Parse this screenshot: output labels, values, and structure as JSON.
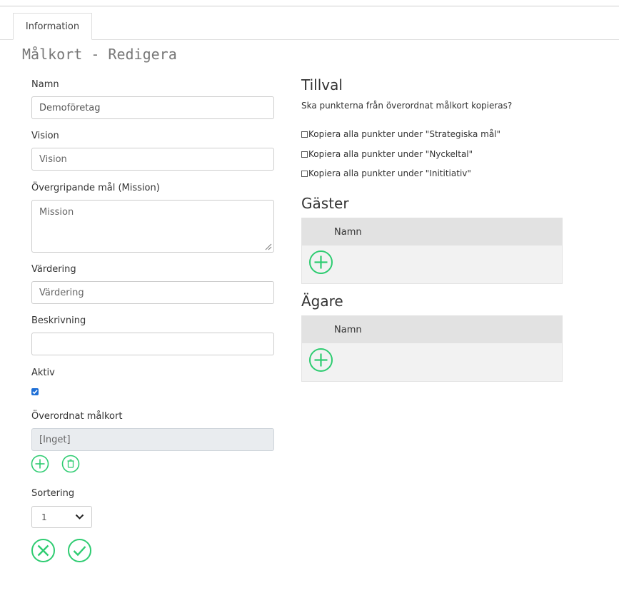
{
  "tabs": [
    {
      "label": "Information"
    }
  ],
  "page_title": "Målkort - Redigera",
  "form": {
    "name": {
      "label": "Namn",
      "value": "Demoföretag"
    },
    "vision": {
      "label": "Vision",
      "placeholder": "Vision"
    },
    "mission": {
      "label": "Övergripande mål (Mission)",
      "placeholder": "Mission"
    },
    "value": {
      "label": "Värdering",
      "placeholder": "Värdering"
    },
    "description": {
      "label": "Beskrivning",
      "value": ""
    },
    "active": {
      "label": "Aktiv",
      "checked": true
    },
    "parent": {
      "label": "Överordnat målkort",
      "value": "[Inget]"
    },
    "sort": {
      "label": "Sortering",
      "value": "1"
    }
  },
  "options": {
    "title": "Tillval",
    "question": "Ska punkterna från överordnat målkort kopieras?",
    "items": [
      {
        "label": "Kopiera alla punkter under \"Strategiska mål\""
      },
      {
        "label": "Kopiera alla punkter under \"Nyckeltal\""
      },
      {
        "label": "Kopiera alla punkter under \"Inititiativ\""
      }
    ]
  },
  "guests": {
    "title": "Gäster",
    "column": "Namn"
  },
  "owners": {
    "title": "Ägare",
    "column": "Namn"
  },
  "colors": {
    "accent": "#2ecc71",
    "checkbox": "#1f6fd6"
  },
  "icons": {
    "add": "plus-circle-icon",
    "delete": "trash-icon",
    "cancel": "x-circle-icon",
    "save": "check-circle-icon",
    "dropdown": "chevron-down-icon"
  }
}
